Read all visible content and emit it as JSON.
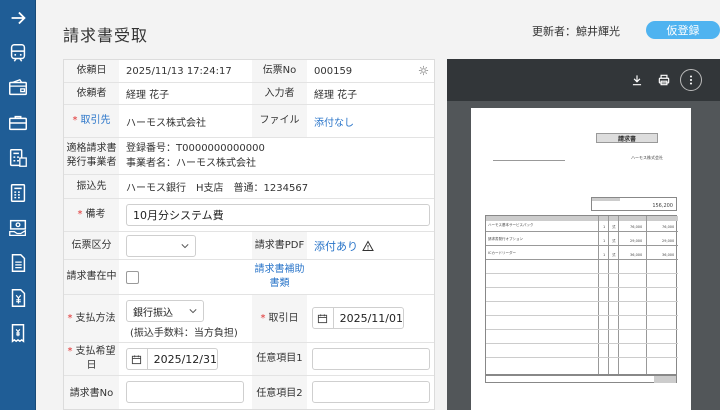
{
  "page": {
    "title": "請求書受取"
  },
  "header": {
    "updater_label": "更新者：鯨井輝光",
    "status_badge": "仮登録"
  },
  "sidebar": {
    "items": [
      {
        "icon": "arrow-right-icon"
      },
      {
        "icon": "train-icon"
      },
      {
        "icon": "wallet-icon"
      },
      {
        "icon": "briefcase-icon"
      },
      {
        "icon": "calculator-list-icon"
      },
      {
        "icon": "calculator-icon"
      },
      {
        "icon": "cash-hand-icon"
      },
      {
        "icon": "document-icon"
      },
      {
        "icon": "yen-document-icon"
      },
      {
        "icon": "receipt-icon"
      }
    ]
  },
  "form": {
    "request_date_label": "依頼日",
    "request_date_value": "2025/11/13 17:24:17",
    "slip_no_label": "伝票No",
    "slip_no_value": "000159",
    "requester_label": "依頼者",
    "requester_value": "経理 花子",
    "entered_by_label": "入力者",
    "entered_by_value": "経理 花子",
    "vendor_label": "取引先",
    "vendor_value": "ハーモス株式会社",
    "file_label": "ファイル",
    "file_value": "添付なし",
    "issuer_label_1": "適格請求書",
    "issuer_label_2": "発行事業者",
    "issuer_reg_no": "登録番号：T0000000000000",
    "issuer_name": "事業者名：ハーモス株式会社",
    "bank_label": "振込先",
    "bank_value": "ハーモス銀行　H支店　普通：1234567",
    "note_label": "備考",
    "note_value": "10月分システム費",
    "slip_type_label": "伝票区分",
    "slip_type_value": "",
    "invoice_pdf_label": "請求書PDF",
    "invoice_pdf_value": "添付あり",
    "invoice_in_label": "請求書在中",
    "invoice_aux_label_1": "請求書補助",
    "invoice_aux_label_2": "書類",
    "payment_method_label": "支払方法",
    "payment_method_value": "銀行振込",
    "payment_fee_note": "(振込手数料：当方負担)",
    "transaction_date_label": "取引日",
    "transaction_date_value": "2025/11/01",
    "desired_pay_label_1": "支払希望",
    "desired_pay_label_2": "日",
    "desired_pay_value": "2025/12/31",
    "optional_1_label": "任意項目1",
    "invoice_no_label": "請求書No",
    "optional_2_label": "任意項目2"
  },
  "viewer": {
    "doc_title": "請求書",
    "doc_company": "ハーモス株式会社",
    "doc_total": "156,200",
    "doc_items": [
      {
        "name": "ハーモス基本サービスパック",
        "qty": "1",
        "unit": "式",
        "price": "76,000",
        "amount": "76,000"
      },
      {
        "name": "請求書発行オプション",
        "qty": "1",
        "unit": "式",
        "price": "29,000",
        "amount": "29,000"
      },
      {
        "name": "ICカードリーダー",
        "qty": "1",
        "unit": "式",
        "price": "36,000",
        "amount": "36,000"
      }
    ]
  },
  "colors": {
    "sidebar": "#1f5d96",
    "accent": "#4fb3f0",
    "link": "#2a75c9",
    "required": "#e03030"
  }
}
